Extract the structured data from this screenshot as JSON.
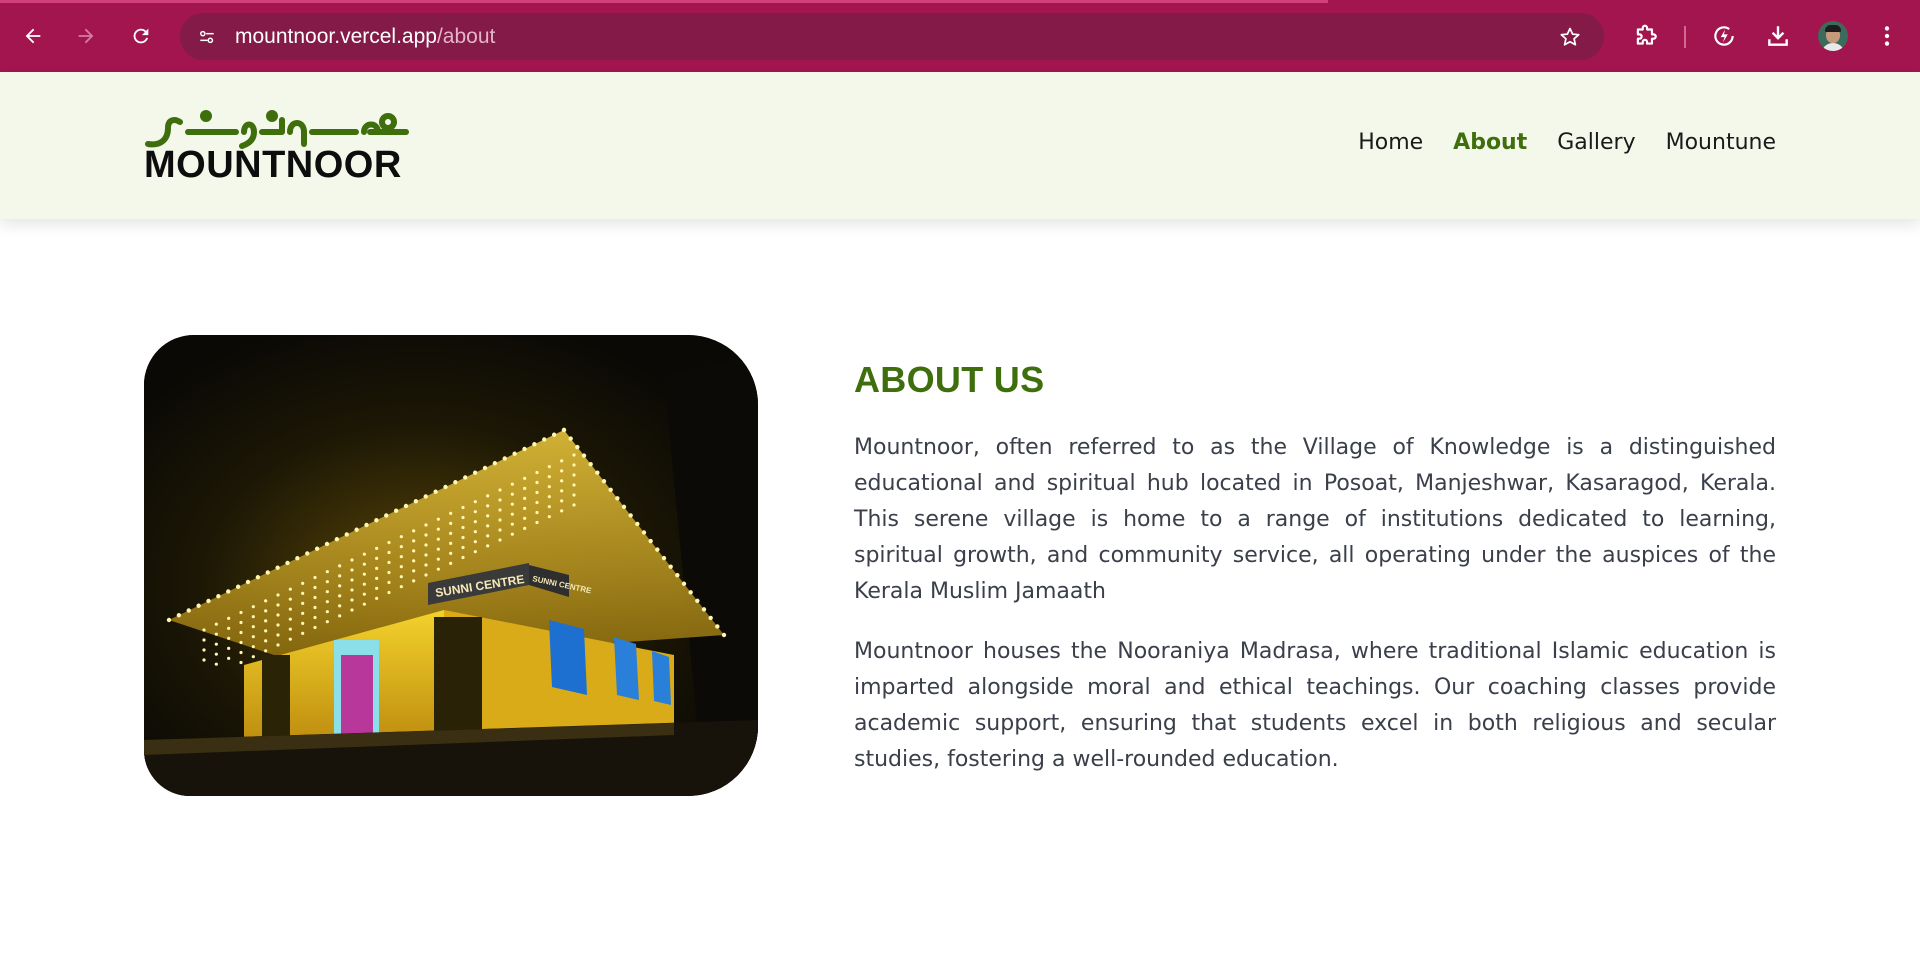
{
  "browser": {
    "url_domain": "mountnoor.vercel.app",
    "url_path": "/about",
    "icons": {
      "back": "back-arrow-icon",
      "forward": "forward-arrow-icon",
      "reload": "reload-icon",
      "site_info": "site-settings-icon",
      "bookmark": "star-icon",
      "extensions": "puzzle-icon",
      "performance": "performance-icon",
      "downloads": "download-icon",
      "profile": "avatar",
      "menu": "kebab-menu-icon"
    },
    "colors": {
      "frame": "#a3154f",
      "omnibox": "#831a48"
    }
  },
  "site": {
    "logo_arabic": "مــونـد نـــور",
    "logo_text": "MOUNTNOOR",
    "nav": [
      {
        "label": "Home",
        "active": false
      },
      {
        "label": "About",
        "active": true
      },
      {
        "label": "Gallery",
        "active": false
      },
      {
        "label": "Mountune",
        "active": false
      }
    ],
    "colors": {
      "accent": "#3f6e0d",
      "header_bg": "#f4f8ea"
    }
  },
  "about": {
    "title": "ABOUT US",
    "image_sign_main": "SUNNI CENTRE",
    "image_sign_side": "SUNNI CENTRE",
    "paragraphs": [
      "Mountnoor, often referred to as the Village of Knowledge is a distinguished educational and spiritual hub located in Posoat, Manjeshwar, Kasaragod, Kerala. This serene village is home to a range of institutions dedicated to learning, spiritual growth, and community service, all operating under the auspices of the Kerala Muslim Jamaath",
      "Mountnoor houses the Nooraniya Madrasa, where traditional Islamic education is imparted alongside moral and ethical teachings. Our coaching classes provide academic support, ensuring that students excel in both religious and secular studies, fostering a well-rounded education."
    ]
  }
}
